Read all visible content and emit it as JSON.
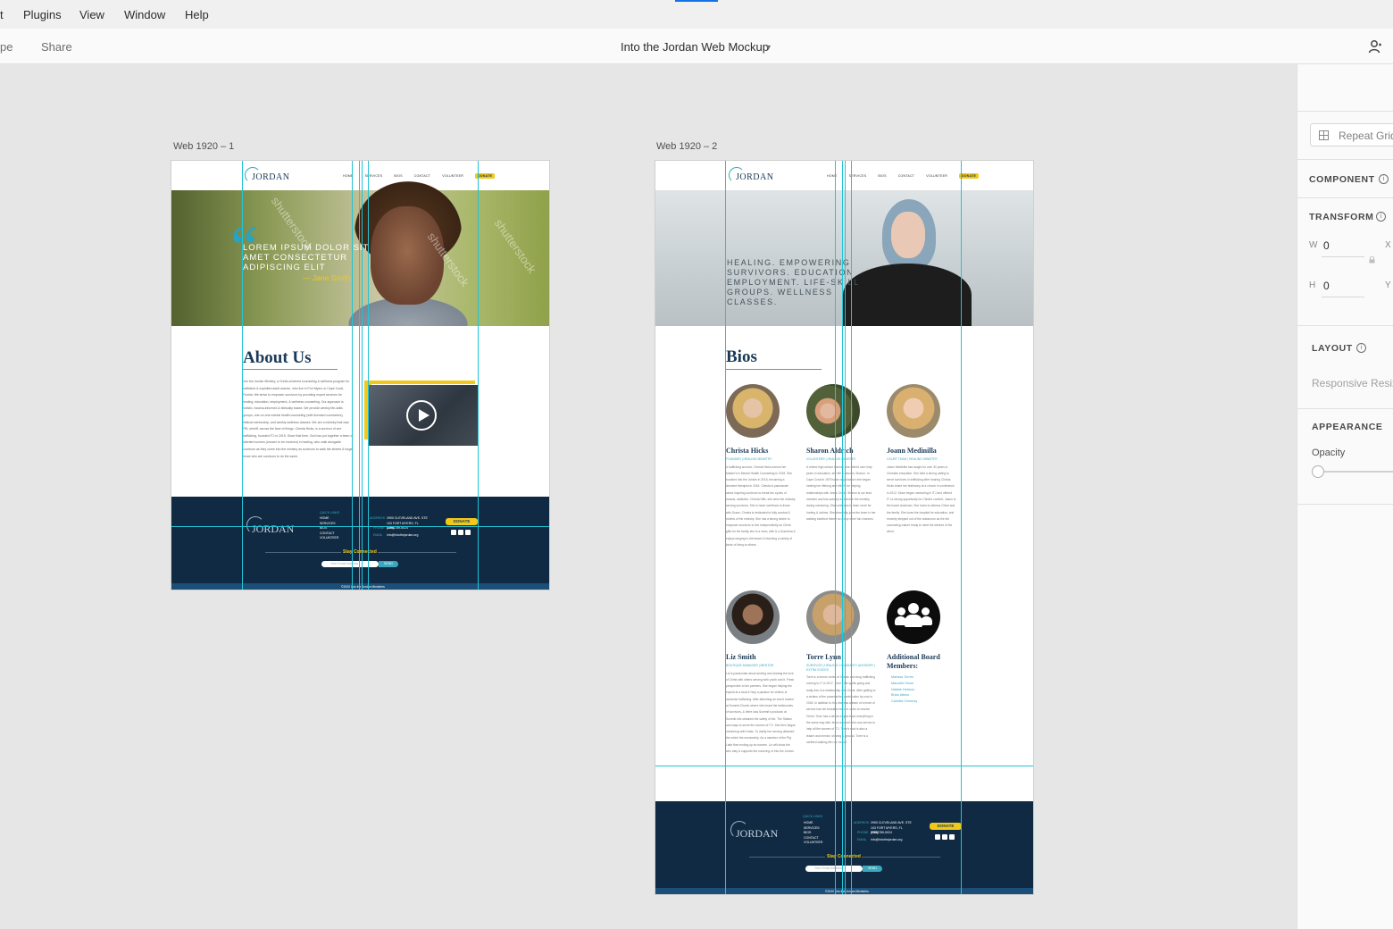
{
  "menu": [
    "t",
    "Plugins",
    "View",
    "Window",
    "Help"
  ],
  "toolbar": {
    "tab_left": "pe",
    "share": "Share",
    "doc_title": "Into the Jordan Web Mockup",
    "user_icon": "user-icon"
  },
  "artboards": [
    {
      "label": "Web 1920 – 1"
    },
    {
      "label": "Web 1920 – 2"
    }
  ],
  "site": {
    "logo_text": "JORDAN",
    "nav": [
      "HOME",
      "SERVICES",
      "BIOS",
      "CONTACT",
      "VOLUNTEER",
      "DONATE"
    ],
    "hero1": {
      "quote": "LOREM IPSUM DOLOR SIT AMET CONSECTETUR ADIPISCING ELIT",
      "author": "— Jane Smith",
      "watermark": "shutterstock"
    },
    "hero2": {
      "text": "HEALING. EMPOWERING SURVIVORS. EDUCATION EMPLOYMENT. LIFE-SKILL GROUPS. WELLNESS CLASSES."
    },
    "about": {
      "title": "About Us",
      "body": "Into the Jordan Ministry, a Christ-centered counseling & wellness program for trafficked & exploited adult women, who live in Fort Myers or Cape Coral, Florida. We strive to empower survivors by providing expert services for healing, education, employment, & wellness counseling. Our approach is holistic, trauma-informed & biblically based. We provide weekly life-skills groups, one-on-one mental health counseling (with licensed counselors), biblical mentorship, and weekly wellness classes. We are a ministry that was FBI, sheriff, across the face of things. Christa Hicks, is a survivor of sex trafficking, founded ITJ in 2015. Since that time, God has put together a team of talented women (chosen to be involved) in healing, who walk alongside survivors as they come into the ministry as survivors to walk the streets & forget those who are survivors to do the same."
    },
    "footer": {
      "quick_links_title": "QUICK LINKS",
      "quick_links": [
        "HOME",
        "SERVICES",
        "BIOS",
        "CONTACT",
        "VOLUNTEER"
      ],
      "address_label": "ADDRESS",
      "address": "2990 Cleveland Ave. Ste 103 Fort Myers, FL 33901",
      "phone_label": "PHONE",
      "phone": "(239) 789-5024",
      "email_label": "EMAIL",
      "email": "info@intothejordan.org",
      "donate": "DONATE",
      "stay_connected": "Stay Connected",
      "email_placeholder": "Your Email Address",
      "send": "SEND",
      "copyright": "©2020 Into the Jordan Ministries"
    },
    "bios": {
      "title": "Bios",
      "people": [
        {
          "name": "Christa Hicks",
          "role": "FOUNDER | HEALING MINISTRY",
          "text": "A trafficking survivor, Christa Hicks earned her Master's in Mental Health Counseling in 2018. She founded Into the Jordan in 2015, becoming a licensed therapist in 2016. Christa is passionate about inspiring survivors to break the cycles of trauma, addiction. Christa Hills, she sees the ministry serving survivors. She is heart overflows to those with Grace, Christa is dedicated to fully combat & victims of the ministry. She has a strong desire to empower survivors to live independently as Christ gifts for the family she is a mom, wife & a Grandma & enjoys ranging to the beach & teaching a variety of kinds of living to others."
        },
        {
          "name": "Sharon Aldrich",
          "role": "VOLUNTEER | HEALING MINISTRY",
          "text": "A retired high school teacher, she retired over forty years in education, she life is adored, Sharon. In Cape Coral in 1975 to an organization she began healing her lifelong and efforts for helping relationships with Jesus Christ. Sharon is our lead member and has actively involved in the ministry during mentoring. She continues to learn more for hurting & victims. She cheerfully joins the team in her walking barefoot theme so many other fun chances."
        },
        {
          "name": "Joann Medinilla",
          "role": "COURT TEAM | HEALING MINISTRY",
          "text": "Joann Medinilla has taught for over 30 years in Christian education. She held a strong calling to serve survivors in trafficking after hearing Christa Hicks share her testimony at a church in conference in 2012. Since began mentoring in ITJ and offered ITJ a strong opportunity for Christ's comfort, Joann is the board chairman. She loves to witness Christ and the family. She loves the hospital for education, and recently stepped out of the classroom as the full counseling trainer ready to meet the desires of the client."
        },
        {
          "name": "Liz Smith",
          "role": "BOUTIQUE MANAGER | MENTOR",
          "text": "Liz is passionate about serving and sharing the love of Christ with others serving both youth and it. Fresh perspective to the partners. She began helping the exploit at a local & help a passion for victims of domestic trafficking. After attending an event hosted at Summit Church where she heard the testimonies of survivors, & there was Summit's products at Summit she obtained the safety of the. The Station and ways to serve the women of ITJ. She then began mentoring with Hosts. To clarify her serving obtained the which the mentorship. As a member of the Pig Lake then ending up an women. Liz will show the who stay & supports the surviving of Into the Jordan."
        },
        {
          "name": "Torre Lynn",
          "role": "SURVIVOR | HEALING COMMUNITY ADVISORY | EXTRA VOICES",
          "text": "Torre is a former victim of human and drug trafficking coming to IT in 2017, Torre's life spells going and really into in a relationship with Christ. After getting to a victims of the power at the contribution by now in 2018. In addition to this she was a team of a heart of service has her beautiful mind in order to receive Christ. Torre has a desire to give back everything in the same way with Jesus in which she now serves to help all the women of ITJ. Torre's soul is also a leader and mentor, sharing & ground. Torre is a certified walking life role model."
        },
        {
          "name": "Additional Board Members:",
          "role": "",
          "text": ""
        }
      ],
      "board_members": [
        "Marissa Torres",
        "Marcelle Howe",
        "Natalie Harmon",
        "Brian Atkins",
        "Carlotta Chesney"
      ]
    }
  },
  "panel": {
    "repeat_grid": "Repeat Grid",
    "component": "COMPONENT",
    "transform": "TRANSFORM",
    "w_label": "W",
    "w_value": "0",
    "x_label": "X",
    "h_label": "H",
    "h_value": "0",
    "y_label": "Y",
    "layout": "LAYOUT",
    "responsive_resize": "Responsive Resize",
    "appearance": "APPEARANCE",
    "opacity": "Opacity"
  },
  "colors": {
    "accent": "#1473e6",
    "guide": "#22c4d6",
    "navy": "#0f2a42",
    "yellow": "#f2c81b",
    "teal": "#3aa9bd"
  }
}
